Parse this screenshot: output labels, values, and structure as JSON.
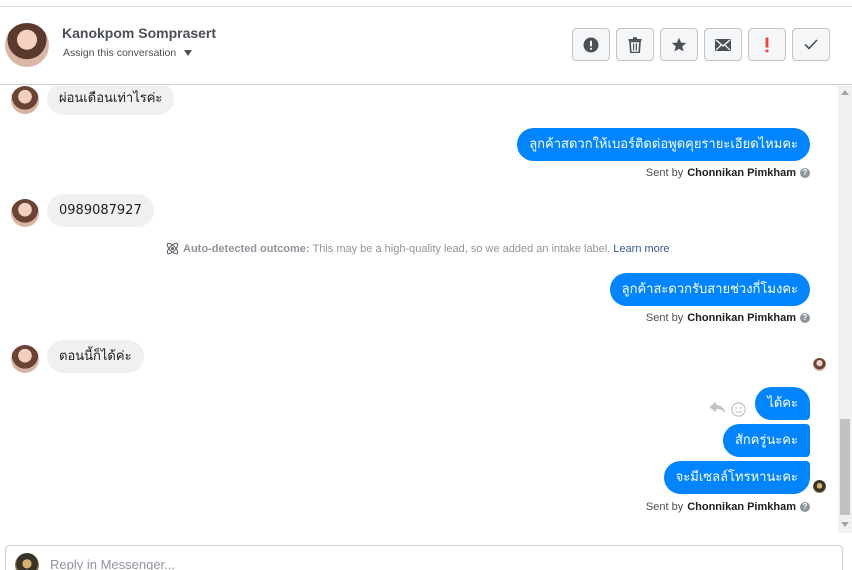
{
  "header": {
    "contact_name": "Kanokpom Somprasert",
    "assign_label": "Assign this conversation"
  },
  "actions": [
    {
      "icon": "alert-circle-icon",
      "color": "#4b4f56"
    },
    {
      "icon": "trash-icon",
      "color": "#4b4f56"
    },
    {
      "icon": "star-icon",
      "color": "#4b4f56"
    },
    {
      "icon": "envelope-icon",
      "color": "#4b4f56"
    },
    {
      "icon": "exclamation-icon",
      "color": "#fa3e3e"
    },
    {
      "icon": "check-icon",
      "color": "#4b4f56"
    }
  ],
  "messages": {
    "m1": "ผ่อนเดือนเท่าไรค่ะ",
    "m2": "ลูกค้าสดวกให้เบอร์ติดต่อพูดคุยรายะเอียดไหมคะ",
    "m3": "0989087927",
    "m4": "ลูกค้าสะดวกรับสายช่วงกี่โมงคะ",
    "m5": "ตอนนี้ก็ได้ค่ะ",
    "m6": "ได้คะ",
    "m7": "สักครู่นะคะ",
    "m8": "จะมีเซลล์โทรหานะคะ"
  },
  "sent_by": {
    "prefix": "Sent by",
    "agent": "Chonnikan Pimkham",
    "help": "?"
  },
  "outcome": {
    "label": "Auto-detected outcome:",
    "text": "This may be a high-quality lead, so we added an intake label.",
    "link": "Learn more"
  },
  "composer": {
    "placeholder": "Reply in Messenger..."
  },
  "colors": {
    "outgoing_bubble": "#0084ff",
    "incoming_bubble": "#f1f0f0",
    "link": "#365899"
  }
}
